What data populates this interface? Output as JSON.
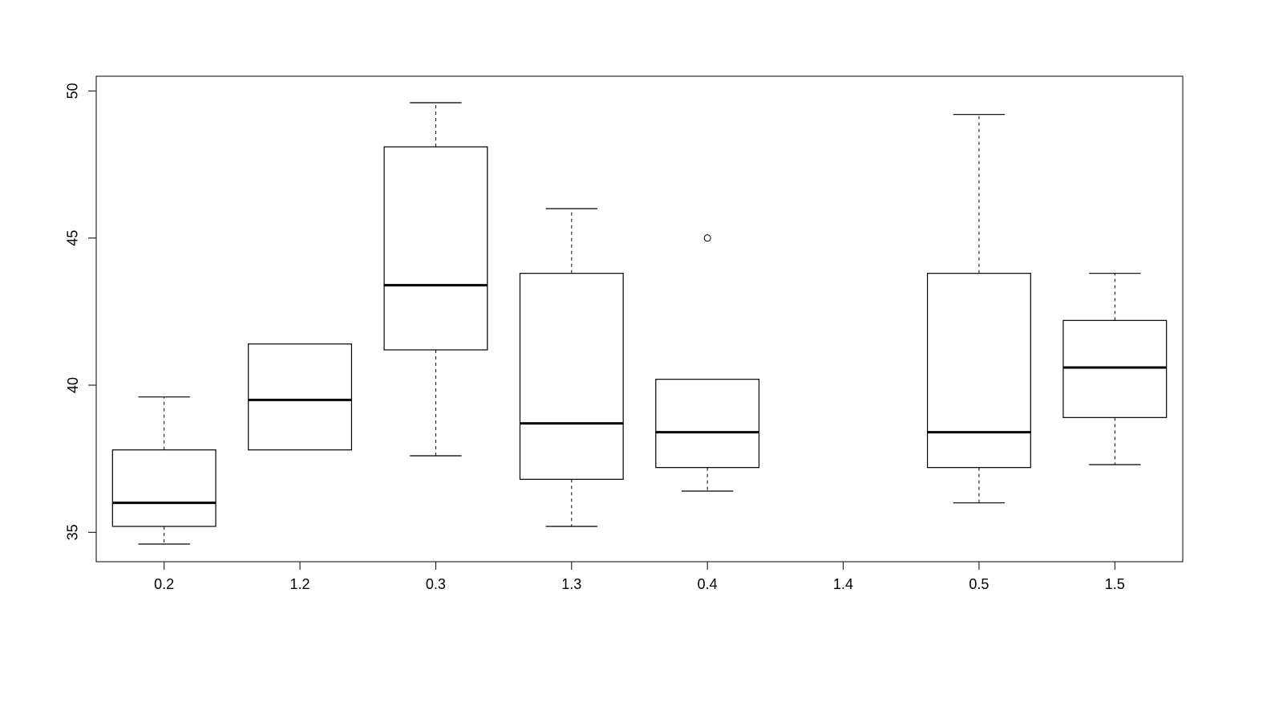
{
  "chart_data": {
    "type": "boxplot",
    "ylim": [
      34,
      50.5
    ],
    "y_ticks": [
      35,
      40,
      45,
      50
    ],
    "categories": [
      "0.2",
      "1.2",
      "0.3",
      "1.3",
      "0.4",
      "1.4",
      "0.5",
      "1.5"
    ],
    "boxes": [
      {
        "category": "0.2",
        "min": 34.6,
        "q1": 35.2,
        "median": 36.0,
        "q3": 37.8,
        "max": 39.6,
        "outliers": []
      },
      {
        "category": "1.2",
        "min": 37.8,
        "q1": 37.8,
        "median": 39.5,
        "q3": 41.4,
        "max": 41.4,
        "outliers": []
      },
      {
        "category": "0.3",
        "min": 37.6,
        "q1": 41.2,
        "median": 43.4,
        "q3": 48.1,
        "max": 49.6,
        "outliers": []
      },
      {
        "category": "1.3",
        "min": 35.2,
        "q1": 36.8,
        "median": 38.7,
        "q3": 43.8,
        "max": 46.0,
        "outliers": []
      },
      {
        "category": "0.4",
        "min": 36.4,
        "q1": 37.2,
        "median": 38.4,
        "q3": 40.2,
        "max": 40.2,
        "outliers": [
          45.0
        ]
      },
      {
        "category": "1.4",
        "empty": true
      },
      {
        "category": "0.5",
        "min": 36.0,
        "q1": 37.2,
        "median": 38.4,
        "q3": 43.8,
        "max": 49.2,
        "outliers": []
      },
      {
        "category": "1.5",
        "min": 37.3,
        "q1": 38.9,
        "median": 40.6,
        "q3": 42.2,
        "max": 43.8,
        "outliers": []
      }
    ],
    "xlabel": "",
    "ylabel": "",
    "title": ""
  }
}
